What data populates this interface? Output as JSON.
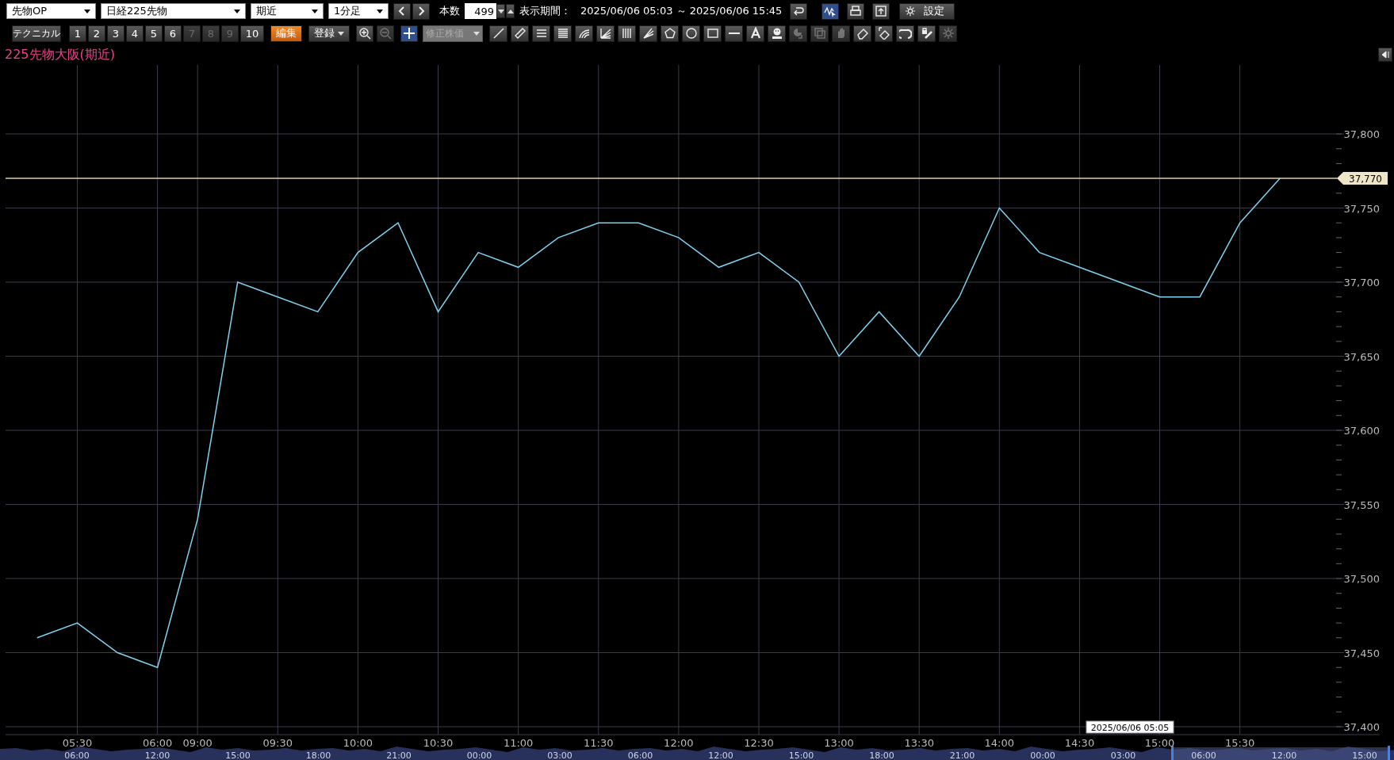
{
  "toolbar": {
    "selects": [
      {
        "value": "先物OP"
      },
      {
        "value": "日経225先物"
      },
      {
        "value": "期近"
      },
      {
        "value": "1分足"
      }
    ],
    "count_label": "本数",
    "count": {
      "value": "499"
    },
    "period_label": "表示期間：",
    "period": "2025/06/06 05:03 ～ 2025/06/06 15:45",
    "icon_buttons": [
      {
        "kind": "undo",
        "selected": false
      },
      {
        "kind": "chart",
        "selected": true
      },
      {
        "kind": "print",
        "selected": false
      },
      {
        "kind": "export",
        "selected": false
      }
    ],
    "settings_button": "設定"
  },
  "toolbar2": {
    "technical": "テクニカル",
    "slots": [
      {
        "label": "1",
        "disabled": false
      },
      {
        "label": "2",
        "disabled": false
      },
      {
        "label": "3",
        "disabled": false
      },
      {
        "label": "4",
        "disabled": false
      },
      {
        "label": "5",
        "disabled": false
      },
      {
        "label": "6",
        "disabled": false
      },
      {
        "label": "7",
        "disabled": true
      },
      {
        "label": "8",
        "disabled": true
      },
      {
        "label": "9",
        "disabled": true
      },
      {
        "label": "10",
        "disabled": false
      }
    ],
    "edit": "編集",
    "register": "登録",
    "zoom": [
      {
        "kind": "zoom-in",
        "disabled": false
      },
      {
        "kind": "zoom-out",
        "disabled": true
      }
    ],
    "crosshair": {
      "selected": true
    },
    "adjusted": {
      "value": "修正株価",
      "disabled": true
    },
    "tools": [
      {
        "kind": "line",
        "disabled": false
      },
      {
        "kind": "ruler",
        "disabled": false
      },
      {
        "kind": "lines3",
        "disabled": false
      },
      {
        "kind": "lines5",
        "disabled": false
      },
      {
        "kind": "arc",
        "disabled": false
      },
      {
        "kind": "fan",
        "disabled": false
      },
      {
        "kind": "vlines",
        "disabled": false
      },
      {
        "kind": "fan2",
        "disabled": false
      },
      {
        "kind": "pentagon",
        "disabled": false
      },
      {
        "kind": "circle",
        "disabled": false
      },
      {
        "kind": "rect",
        "disabled": false
      },
      {
        "kind": "hline",
        "disabled": false
      },
      {
        "kind": "text",
        "disabled": false
      },
      {
        "kind": "smiley",
        "disabled": false
      },
      {
        "kind": "return",
        "disabled": true
      },
      {
        "kind": "copy",
        "disabled": true
      },
      {
        "kind": "hand",
        "disabled": true
      },
      {
        "kind": "eraser",
        "disabled": false
      },
      {
        "kind": "eraser2",
        "disabled": false
      },
      {
        "kind": "magnet",
        "disabled": false
      },
      {
        "kind": "lock",
        "disabled": false
      },
      {
        "kind": "gear",
        "disabled": true
      }
    ]
  },
  "chart": {
    "tooltip": "2025/06/06 05:05",
    "navigator_labels": [
      "06:00",
      "12:00",
      "15:00",
      "18:00",
      "21:00",
      "00:00",
      "03:00",
      "06:00",
      "12:00",
      "15:00",
      "18:00",
      "21:00",
      "00:00",
      "03:00",
      "06:00",
      "12:00",
      "15:00"
    ],
    "chart_data": {
      "type": "line",
      "grid": true,
      "ylim": [
        37400,
        37800
      ],
      "ref_lines": [
        {
          "axis": "y",
          "value": 37770,
          "label": "37,770",
          "color": "#d8d0b0"
        }
      ],
      "yticks": [
        {
          "value": 37400,
          "label": "37,400"
        },
        {
          "value": 37450,
          "label": "37,450"
        },
        {
          "value": 37500,
          "label": "37,500"
        },
        {
          "value": 37550,
          "label": "37,550"
        },
        {
          "value": 37600,
          "label": "37,600"
        },
        {
          "value": 37650,
          "label": "37,650"
        },
        {
          "value": 37700,
          "label": "37,700"
        },
        {
          "value": 37750,
          "label": "37,750"
        },
        {
          "value": 37800,
          "label": "37,800"
        }
      ],
      "categories": [
        null,
        "05:30",
        null,
        "06:00",
        "09:00",
        null,
        "09:30",
        null,
        "10:00",
        null,
        "10:30",
        null,
        "11:00",
        null,
        "11:30",
        null,
        "12:00",
        null,
        "12:30",
        null,
        "13:00",
        null,
        "13:30",
        null,
        "14:00",
        null,
        "14:30",
        null,
        "15:00",
        null,
        "15:30",
        null
      ],
      "series": [
        {
          "name": "225先物大阪(期近)",
          "color": "#7fd3f0",
          "values": [
            37460,
            37470,
            37450,
            37440,
            37540,
            37700,
            37690,
            37680,
            37720,
            37740,
            37680,
            37720,
            37710,
            37730,
            37740,
            37740,
            37730,
            37710,
            37720,
            37700,
            37650,
            37680,
            37650,
            37690,
            37750,
            37720,
            37710,
            37700,
            37690,
            37690,
            37740,
            37770
          ]
        }
      ]
    }
  }
}
